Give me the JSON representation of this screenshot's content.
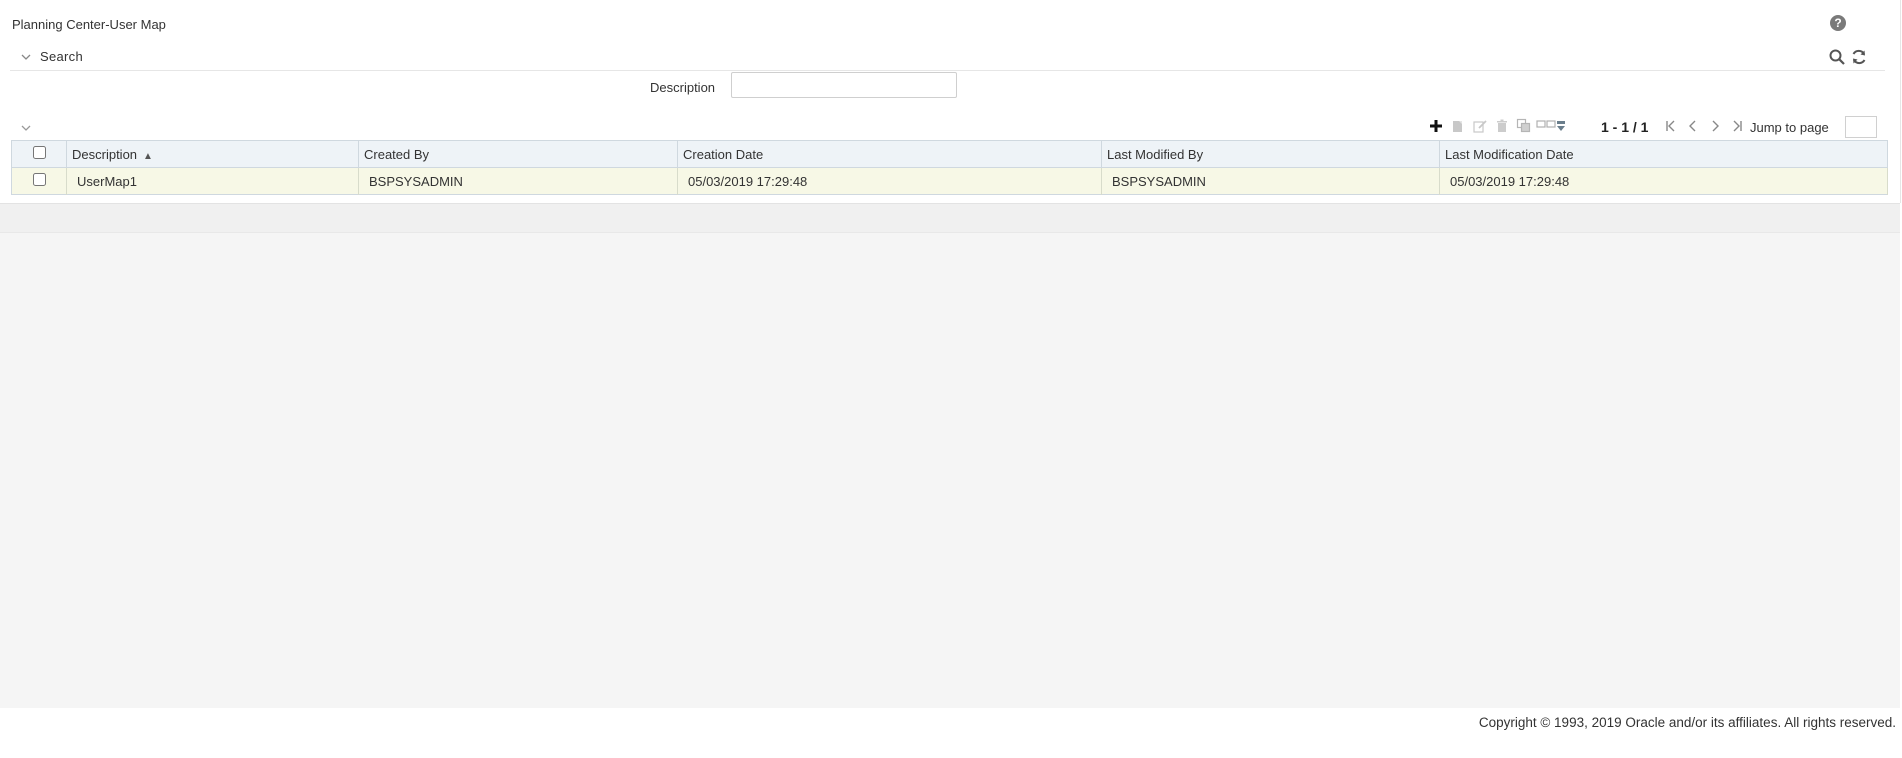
{
  "page": {
    "title": "Planning Center-User Map"
  },
  "search": {
    "label": "Search",
    "fields": {
      "description_label": "Description",
      "description_value": "",
      "description_placeholder": ""
    }
  },
  "icons": {
    "help": "help-icon",
    "search": "search-icon",
    "reset": "refresh-icon",
    "add": "plus-icon",
    "copy": "copy-icon",
    "edit": "edit-icon",
    "delete": "delete-icon",
    "multi_copy": "duplicate-icon",
    "column_settings": "columns-icon"
  },
  "pager": {
    "range_text": "1 - 1 / 1",
    "jump_label": "Jump to page",
    "jump_value": ""
  },
  "grid": {
    "columns": [
      {
        "label": "Description",
        "sorted": "asc"
      },
      {
        "label": "Created By"
      },
      {
        "label": "Creation Date"
      },
      {
        "label": "Last Modified By"
      },
      {
        "label": "Last Modification Date"
      }
    ],
    "rows": [
      {
        "description": "UserMap1",
        "created_by": "BSPSYSADMIN",
        "creation_date": "05/03/2019 17:29:48",
        "last_modified_by": "BSPSYSADMIN",
        "last_modification_date": "05/03/2019 17:29:48"
      }
    ]
  },
  "footer": {
    "copyright": "Copyright © 1993, 2019 Oracle and/or its affiliates. All rights reserved."
  },
  "colors": {
    "header_bg": "#eef3f7",
    "row_bg": "#f7f8e6",
    "page_bg": "#f5f5f5"
  }
}
